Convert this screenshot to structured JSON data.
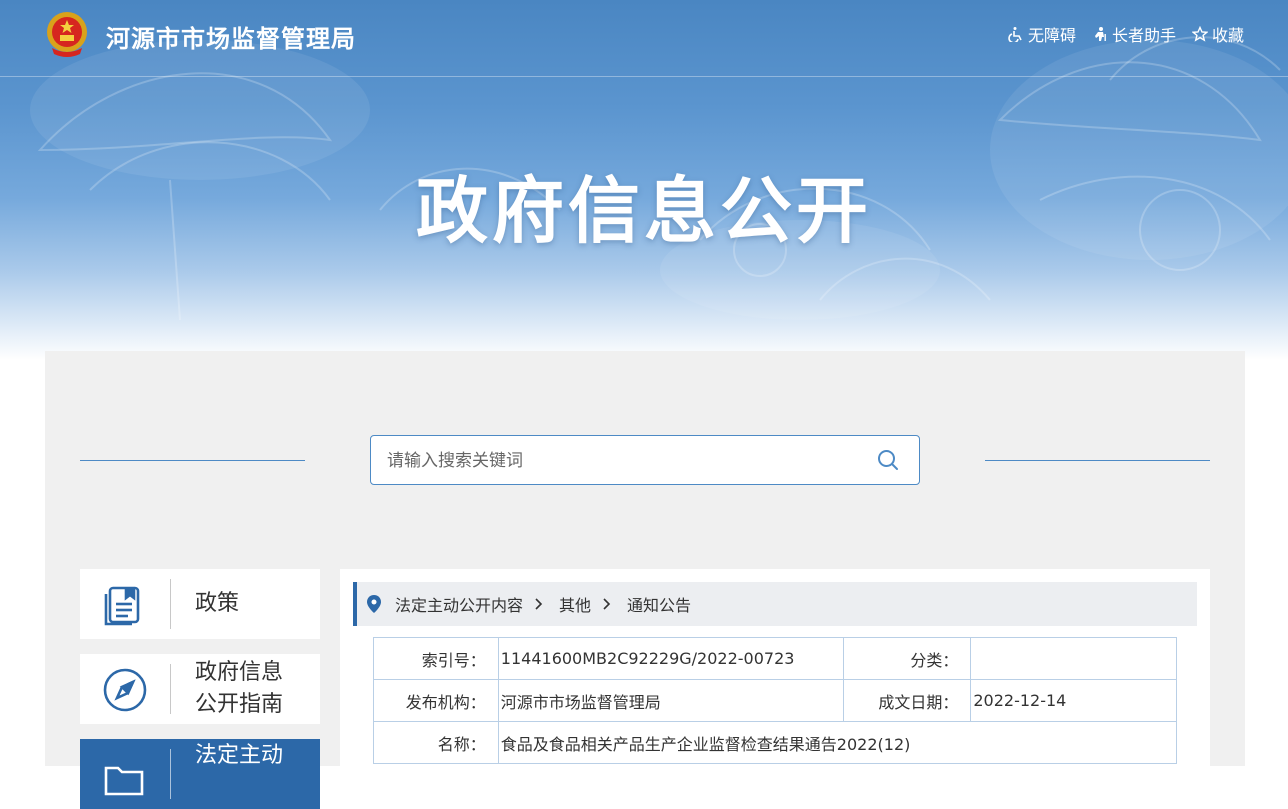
{
  "header": {
    "site_name": "河源市市场监督管理局",
    "tools": [
      {
        "label": "无障碍",
        "icon": "wheelchair-icon"
      },
      {
        "label": "长者助手",
        "icon": "elder-icon"
      },
      {
        "label": "收藏",
        "icon": "star-icon"
      }
    ]
  },
  "hero": {
    "title": "政府信息公开"
  },
  "search": {
    "placeholder": "请输入搜索关键词",
    "icon": "search-icon"
  },
  "nav": {
    "items": [
      {
        "label": "政策",
        "icon": "document-icon",
        "active": false
      },
      {
        "label_line1": "政府信息",
        "label_line2": "公开指南",
        "icon": "compass-icon",
        "active": false
      },
      {
        "label_line1": "法定主动",
        "icon": "folder-icon",
        "active": true
      }
    ]
  },
  "breadcrumb": [
    "法定主动公开内容",
    "其他",
    "通知公告"
  ],
  "meta": {
    "index_label": "索引号：",
    "index_value": "11441600MB2C92229G/2022-00723",
    "category_label": "分类：",
    "category_value": "",
    "publisher_label": "发布机构：",
    "publisher_value": "河源市市场监督管理局",
    "date_label": "成文日期：",
    "date_value": "2022-12-14",
    "name_label": "名称：",
    "name_value": "食品及食品相关产品生产企业监督检查结果通告2022(12)"
  },
  "colors": {
    "primary": "#2c68a8",
    "accent_line": "#4d8ac5",
    "panel_bg": "#f0f0f0"
  }
}
